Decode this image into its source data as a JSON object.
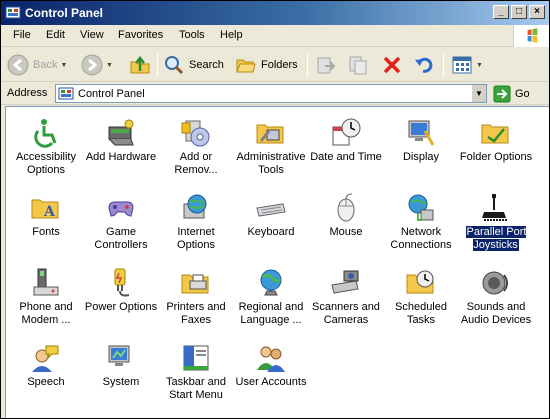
{
  "window": {
    "title": "Control Panel"
  },
  "menu": [
    "File",
    "Edit",
    "View",
    "Favorites",
    "Tools",
    "Help"
  ],
  "toolbar": {
    "back_label": "Back",
    "search_label": "Search",
    "folders_label": "Folders"
  },
  "address": {
    "label": "Address",
    "value": "Control Panel",
    "go_label": "Go"
  },
  "items": [
    {
      "label": "Accessibility Options",
      "icon": "accessibility-icon"
    },
    {
      "label": "Add Hardware",
      "icon": "add-hardware-icon"
    },
    {
      "label": "Add or Remov...",
      "icon": "add-remove-programs-icon"
    },
    {
      "label": "Administrative Tools",
      "icon": "administrative-tools-icon"
    },
    {
      "label": "Date and Time",
      "icon": "date-time-icon"
    },
    {
      "label": "Display",
      "icon": "display-icon"
    },
    {
      "label": "Folder Options",
      "icon": "folder-options-icon"
    },
    {
      "label": "Fonts",
      "icon": "fonts-icon"
    },
    {
      "label": "Game Controllers",
      "icon": "game-controllers-icon"
    },
    {
      "label": "Internet Options",
      "icon": "internet-options-icon"
    },
    {
      "label": "Keyboard",
      "icon": "keyboard-icon"
    },
    {
      "label": "Mouse",
      "icon": "mouse-icon"
    },
    {
      "label": "Network Connections",
      "icon": "network-connections-icon"
    },
    {
      "label": "Parallel Port Joysticks",
      "icon": "parallel-port-joystick-icon",
      "selected": true
    },
    {
      "label": "Phone and Modem ...",
      "icon": "phone-modem-icon"
    },
    {
      "label": "Power Options",
      "icon": "power-options-icon"
    },
    {
      "label": "Printers and Faxes",
      "icon": "printers-faxes-icon"
    },
    {
      "label": "Regional and Language ...",
      "icon": "regional-language-icon"
    },
    {
      "label": "Scanners and Cameras",
      "icon": "scanners-cameras-icon"
    },
    {
      "label": "Scheduled Tasks",
      "icon": "scheduled-tasks-icon"
    },
    {
      "label": "Sounds and Audio Devices",
      "icon": "sounds-audio-icon"
    },
    {
      "label": "Speech",
      "icon": "speech-icon"
    },
    {
      "label": "System",
      "icon": "system-icon"
    },
    {
      "label": "Taskbar and Start Menu",
      "icon": "taskbar-start-menu-icon"
    },
    {
      "label": "User Accounts",
      "icon": "user-accounts-icon"
    }
  ],
  "colors": {
    "title_bar": "#0A246A",
    "selection": "#0A246A",
    "chrome": "#ECE9D8"
  }
}
